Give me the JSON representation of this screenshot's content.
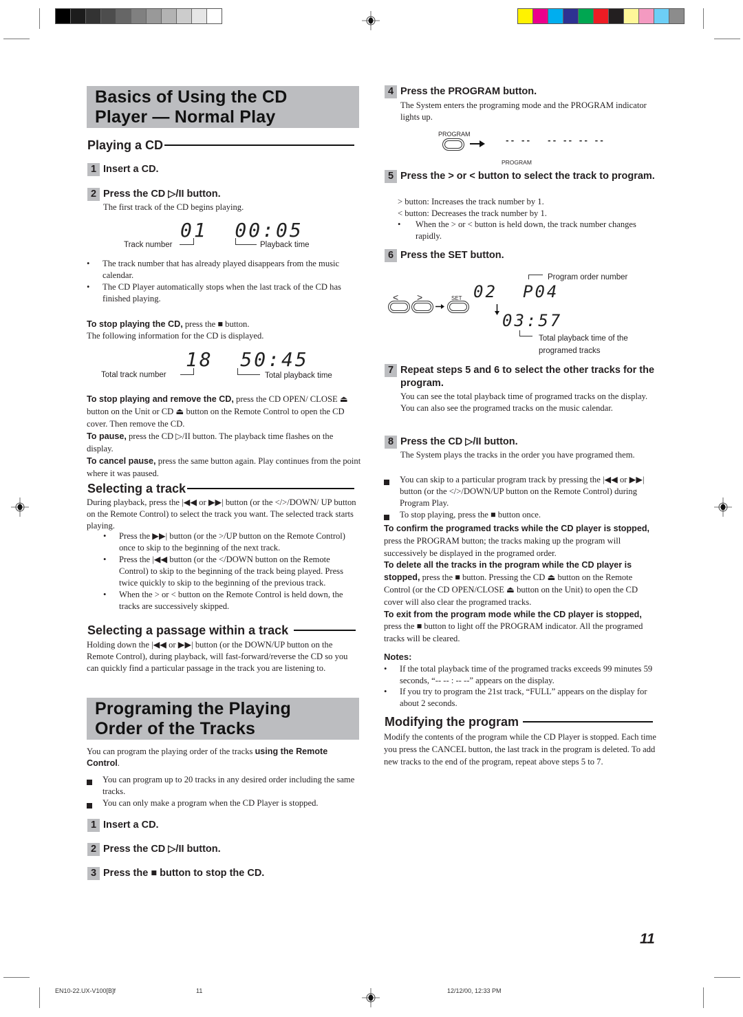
{
  "print_marks": {
    "gray_swatches": [
      "#000000",
      "#1c1c1c",
      "#333333",
      "#4d4d4d",
      "#666666",
      "#808080",
      "#999999",
      "#b3b3b3",
      "#cccccc",
      "#e6e6e6",
      "#ffffff"
    ],
    "color_swatches": [
      "#fff200",
      "#ec008c",
      "#00aeef",
      "#2e3192",
      "#00a651",
      "#ed1c24",
      "#231f20",
      "#fff799",
      "#f49ac1",
      "#6dcff6",
      "#8c8c8c"
    ]
  },
  "left": {
    "title": [
      "Basics of Using the CD",
      "Player — Normal Play"
    ],
    "playing_cd": {
      "heading": "Playing a CD",
      "step1": {
        "num": "1",
        "text": "Insert a CD."
      },
      "step2": {
        "num": "2",
        "text": "Press the CD ▷/II button.",
        "desc": "The first track of the CD begins playing."
      },
      "display1": {
        "value": "01  00:05",
        "label_left": "Track number",
        "label_right": "Playback time"
      },
      "bullets": [
        "The track number that has already played disappears from the music calendar.",
        "The CD Player automatically stops when the last track of the CD has finished playing."
      ],
      "stop_lead": "To stop playing the CD,",
      "stop_rest": " press the ■ button.",
      "stop_info": "The following information for the CD is displayed.",
      "display2": {
        "value": "18  50:45",
        "label_left": "Total track number",
        "label_right": "Total playback time"
      },
      "remove_lead": "To stop playing and remove the CD,",
      "remove_rest": " press the CD OPEN/ CLOSE ⏏ button on the Unit or CD ⏏ button on the Remote Control to open the CD cover. Then remove the CD.",
      "pause_lead": "To pause,",
      "pause_rest": " press the CD ▷/II button. The playback time flashes on the display.",
      "cancel_lead": "To cancel pause,",
      "cancel_rest": " press the same button again. Play continues from the point where it was paused."
    },
    "selecting_track": {
      "heading": "Selecting a track",
      "intro": "During playback, press the |◀◀ or ▶▶| button (or the </>/DOWN/ UP button on the Remote Control) to select the track you want. The selected track starts playing.",
      "bullets": [
        "Press the ▶▶| button (or the >/UP button on the Remote Control) once to skip to the beginning of the next track.",
        "Press the |◀◀ button (or the </DOWN button on the Remote Control) to skip to the beginning of the track being played. Press twice quickly to skip to the beginning of the previous track.",
        "When the > or < button on the Remote Control is held down, the tracks are successively skipped."
      ]
    },
    "selecting_passage": {
      "heading": "Selecting a passage within a track",
      "text": "Holding down the |◀◀ or ▶▶| button (or the DOWN/UP button on the Remote Control), during playback, will fast-forward/reverse the CD so you can quickly find a particular passage in the track you are listening to."
    },
    "program_title": [
      "Programing the Playing",
      "Order of the Tracks"
    ],
    "program_intro_plain": "You can program the playing order of the tracks ",
    "program_intro_bold": "using the Remote Control",
    "program_intro_end": ".",
    "program_bullets": [
      "You can program up to 20 tracks in any desired order including the same tracks.",
      "You can only make a program when the CD Player is stopped."
    ],
    "program_steps": [
      {
        "num": "1",
        "text": "Insert a CD."
      },
      {
        "num": "2",
        "text": "Press the CD ▷/II button."
      },
      {
        "num": "3",
        "text": "Press the ■ button to stop the CD."
      }
    ]
  },
  "right": {
    "step4": {
      "num": "4",
      "text": "Press the PROGRAM button.",
      "desc": "The System enters the programing mode and the PROGRAM indicator lights up.",
      "button_label": "PROGRAM",
      "display_value": "-- --   -- -- -- --",
      "indicator_label": "PROGRAM"
    },
    "step5": {
      "num": "5",
      "text": "Press the > or < button to select the track to program.",
      "lines": [
        "> button:  Increases the track number by 1.",
        "< button:  Decreases the track number by 1."
      ],
      "bullet": "When the > or < button is held down, the track number changes rapidly."
    },
    "step6": {
      "num": "6",
      "text": "Press the SET button.",
      "btn_prev": "<",
      "btn_next": ">",
      "btn_set": "SET",
      "display_track": "02",
      "display_order": "P04",
      "display_time": "03:57",
      "label_order": "Program order number",
      "label_time": "Total playback time of the programed tracks"
    },
    "step7": {
      "num": "7",
      "text": "Repeat steps 5 and 6 to select the other tracks for the program.",
      "desc": "You can see the total playback time of programed tracks on the display. You can also see the programed tracks on the music calendar."
    },
    "step8": {
      "num": "8",
      "text": "Press the CD ▷/II button.",
      "desc": "The System plays the tracks in the order you have programed them."
    },
    "step8_bullets": [
      "You can skip to a particular program track by pressing the |◀◀ or ▶▶| button (or the </>/DOWN/UP button on the Remote Control) during Program Play.",
      "To stop playing, press the ■ button once."
    ],
    "confirm_lead": "To confirm the programed tracks while the CD player is stopped,",
    "confirm_rest": " press the PROGRAM button; the tracks making up the program will successively be displayed in the programed order.",
    "delete_lead": "To delete all the tracks in the program while the CD player is stopped,",
    "delete_rest": " press the ■ button. Pressing the CD ⏏ button on the Remote Control (or the CD OPEN/CLOSE ⏏ button on the Unit) to open the CD cover will also clear the programed tracks.",
    "exit_lead": "To exit from the program mode while the CD player is stopped,",
    "exit_rest": " press the ■ button to light off the PROGRAM indicator. All the programed tracks will be cleared.",
    "notes_title": "Notes:",
    "notes": [
      "If the total playback time of the programed tracks exceeds 99 minutes 59 seconds, “-- -- : -- --” appears on the display.",
      "If you try to program the 21st track, “FULL” appears on the display for about 2 seconds."
    ],
    "modify": {
      "heading": "Modifying the program",
      "text": "Modify the contents of the program while the CD Player is stopped. Each time you press the CANCEL button, the last track in the program is deleted. To add new tracks to the end of the program, repeat above steps 5 to 7."
    }
  },
  "page_number": "11",
  "footer": {
    "file": "EN10-22.UX-V100[B]f",
    "page": "11",
    "datetime": "12/12/00, 12:33 PM"
  }
}
